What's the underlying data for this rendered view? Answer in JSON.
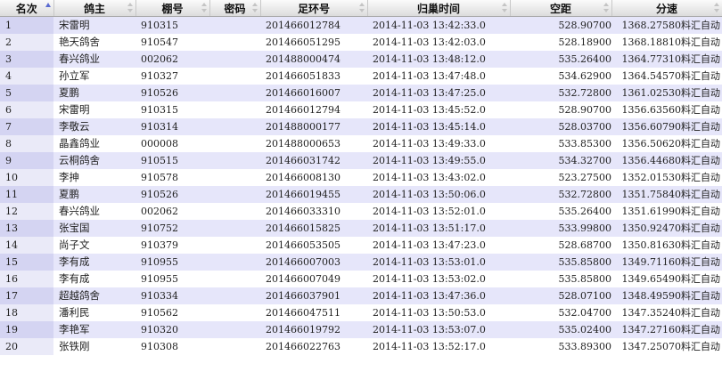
{
  "table": {
    "columns": [
      "名次",
      "鸽主",
      "棚号",
      "密码",
      "足环号",
      "归巢时间",
      "空距",
      "分速"
    ],
    "sorted_column": "名次",
    "sort_direction": "ascending",
    "rows": [
      {
        "rank": "1",
        "owner": "宋雷明",
        "loft": "910315",
        "password": "",
        "ring": "201466012784",
        "time": "2014-11-03 13:42:33.0",
        "distance": "528.90700",
        "speed": "1368.27580料汇自动"
      },
      {
        "rank": "2",
        "owner": "艳天鸽舍",
        "loft": "910547",
        "password": "",
        "ring": "201466051295",
        "time": "2014-11-03 13:42:03.0",
        "distance": "528.18900",
        "speed": "1368.18810料汇自动"
      },
      {
        "rank": "3",
        "owner": "春兴鸽业",
        "loft": "002062",
        "password": "",
        "ring": "201488000474",
        "time": "2014-11-03 13:48:12.0",
        "distance": "535.26400",
        "speed": "1364.77310料汇自动"
      },
      {
        "rank": "4",
        "owner": "孙立军",
        "loft": "910327",
        "password": "",
        "ring": "201466051833",
        "time": "2014-11-03 13:47:48.0",
        "distance": "534.62900",
        "speed": "1364.54570料汇自动"
      },
      {
        "rank": "5",
        "owner": "夏鹏",
        "loft": "910526",
        "password": "",
        "ring": "201466016007",
        "time": "2014-11-03 13:47:25.0",
        "distance": "532.72800",
        "speed": "1361.02530料汇自动"
      },
      {
        "rank": "6",
        "owner": "宋雷明",
        "loft": "910315",
        "password": "",
        "ring": "201466012794",
        "time": "2014-11-03 13:45:52.0",
        "distance": "528.90700",
        "speed": "1356.63560料汇自动"
      },
      {
        "rank": "7",
        "owner": "李敬云",
        "loft": "910314",
        "password": "",
        "ring": "201488000177",
        "time": "2014-11-03 13:45:14.0",
        "distance": "528.03700",
        "speed": "1356.60790料汇自动"
      },
      {
        "rank": "8",
        "owner": "晶鑫鸽业",
        "loft": "000008",
        "password": "",
        "ring": "201488000653",
        "time": "2014-11-03 13:49:33.0",
        "distance": "533.85300",
        "speed": "1356.50620料汇自动"
      },
      {
        "rank": "9",
        "owner": "云桐鸽舍",
        "loft": "910515",
        "password": "",
        "ring": "201466031742",
        "time": "2014-11-03 13:49:55.0",
        "distance": "534.32700",
        "speed": "1356.44680料汇自动"
      },
      {
        "rank": "10",
        "owner": "李抻",
        "loft": "910578",
        "password": "",
        "ring": "201466008130",
        "time": "2014-11-03 13:43:02.0",
        "distance": "523.27500",
        "speed": "1352.01530料汇自动"
      },
      {
        "rank": "11",
        "owner": "夏鹏",
        "loft": "910526",
        "password": "",
        "ring": "201466019455",
        "time": "2014-11-03 13:50:06.0",
        "distance": "532.72800",
        "speed": "1351.75840料汇自动"
      },
      {
        "rank": "12",
        "owner": "春兴鸽业",
        "loft": "002062",
        "password": "",
        "ring": "201466033310",
        "time": "2014-11-03 13:52:01.0",
        "distance": "535.26400",
        "speed": "1351.61990料汇自动"
      },
      {
        "rank": "13",
        "owner": "张宝国",
        "loft": "910752",
        "password": "",
        "ring": "201466015825",
        "time": "2014-11-03 13:51:17.0",
        "distance": "533.99800",
        "speed": "1350.92470料汇自动"
      },
      {
        "rank": "14",
        "owner": "尚子文",
        "loft": "910379",
        "password": "",
        "ring": "201466053505",
        "time": "2014-11-03 13:47:23.0",
        "distance": "528.68700",
        "speed": "1350.81630料汇自动"
      },
      {
        "rank": "15",
        "owner": "李有成",
        "loft": "910955",
        "password": "",
        "ring": "201466007003",
        "time": "2014-11-03 13:53:01.0",
        "distance": "535.85800",
        "speed": "1349.71160料汇自动"
      },
      {
        "rank": "16",
        "owner": "李有成",
        "loft": "910955",
        "password": "",
        "ring": "201466007049",
        "time": "2014-11-03 13:53:02.0",
        "distance": "535.85800",
        "speed": "1349.65490料汇自动"
      },
      {
        "rank": "17",
        "owner": "超越鸽舍",
        "loft": "910334",
        "password": "",
        "ring": "201466037901",
        "time": "2014-11-03 13:47:36.0",
        "distance": "528.07100",
        "speed": "1348.49590料汇自动"
      },
      {
        "rank": "18",
        "owner": "潘利民",
        "loft": "910562",
        "password": "",
        "ring": "201466047511",
        "time": "2014-11-03 13:50:53.0",
        "distance": "532.04700",
        "speed": "1347.35240料汇自动"
      },
      {
        "rank": "19",
        "owner": "李艳军",
        "loft": "910320",
        "password": "",
        "ring": "201466019792",
        "time": "2014-11-03 13:53:07.0",
        "distance": "535.02400",
        "speed": "1347.27160料汇自动"
      },
      {
        "rank": "20",
        "owner": "张铁刚",
        "loft": "910308",
        "password": "",
        "ring": "201466022763",
        "time": "2014-11-03 13:52:17.0",
        "distance": "533.89300",
        "speed": "1347.25070料汇自动"
      }
    ]
  },
  "colors": {
    "row_odd": "#e6e6fa",
    "row_even": "#ffffff",
    "sort_arrow_active": "#5a6ad0",
    "sort_arrow_inactive": "#c4c4c4"
  }
}
